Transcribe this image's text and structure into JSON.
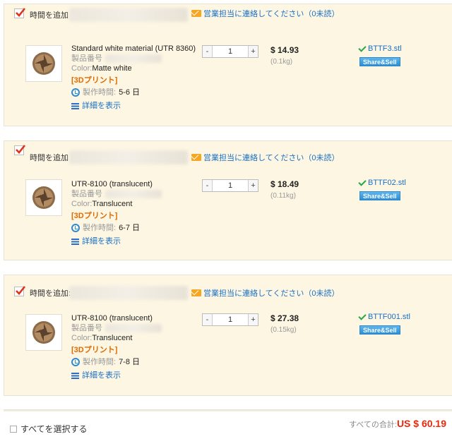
{
  "cart_items": [
    {
      "add_time_label": "時間を追加",
      "contact_label": "営業担当に連絡してください（0未読）",
      "product_name": "Standard white material (UTR 8360)",
      "product_no_label": "製品番号",
      "color_label": "Color:",
      "color_value": "Matte white",
      "tag": "[3Dプリント]",
      "lead_time_label": "製作時間:",
      "lead_time_value": "5-6 日",
      "details_label": "詳細を表示",
      "quantity": "1",
      "price": "$ 14.93",
      "weight": "(0.1kg)",
      "file_name": "BTTF3.stl",
      "share_label": "Share&Sell"
    },
    {
      "add_time_label": "時間を追加",
      "contact_label": "営業担当に連絡してください（0未読）",
      "product_name": "UTR-8100 (translucent)",
      "product_no_label": "製品番号",
      "color_label": "Color:",
      "color_value": "Translucent",
      "tag": "[3Dプリント]",
      "lead_time_label": "製作時間:",
      "lead_time_value": "6-7 日",
      "details_label": "詳細を表示",
      "quantity": "1",
      "price": "$ 18.49",
      "weight": "(0.11kg)",
      "file_name": "BTTF02.stl",
      "share_label": "Share&Sell"
    },
    {
      "add_time_label": "時間を追加:",
      "contact_label": "営業担当に連絡してください（0未読）",
      "product_name": "UTR-8100 (translucent)",
      "product_no_label": "製品番号",
      "color_label": "Color:",
      "color_value": "Translucent",
      "tag": "[3Dプリント]",
      "lead_time_label": "製作時間:",
      "lead_time_value": "7-8 日",
      "details_label": "詳細を表示",
      "quantity": "1",
      "price": "$ 27.38",
      "weight": "(0.15kg)",
      "file_name": "BTTF001.stl",
      "share_label": "Share&Sell"
    }
  ],
  "qty_minus": "-",
  "qty_plus": "+",
  "footer": {
    "select_all_label": "すべてを選択する",
    "total_label": "すべての合計:",
    "total_amount": "US $ 60.19"
  },
  "colors": {
    "card_bg": "#fdf6e3",
    "link": "#1a6fc4",
    "accent_orange": "#e06a00",
    "total_red": "#e8290c",
    "check_green": "#2aa54a"
  }
}
